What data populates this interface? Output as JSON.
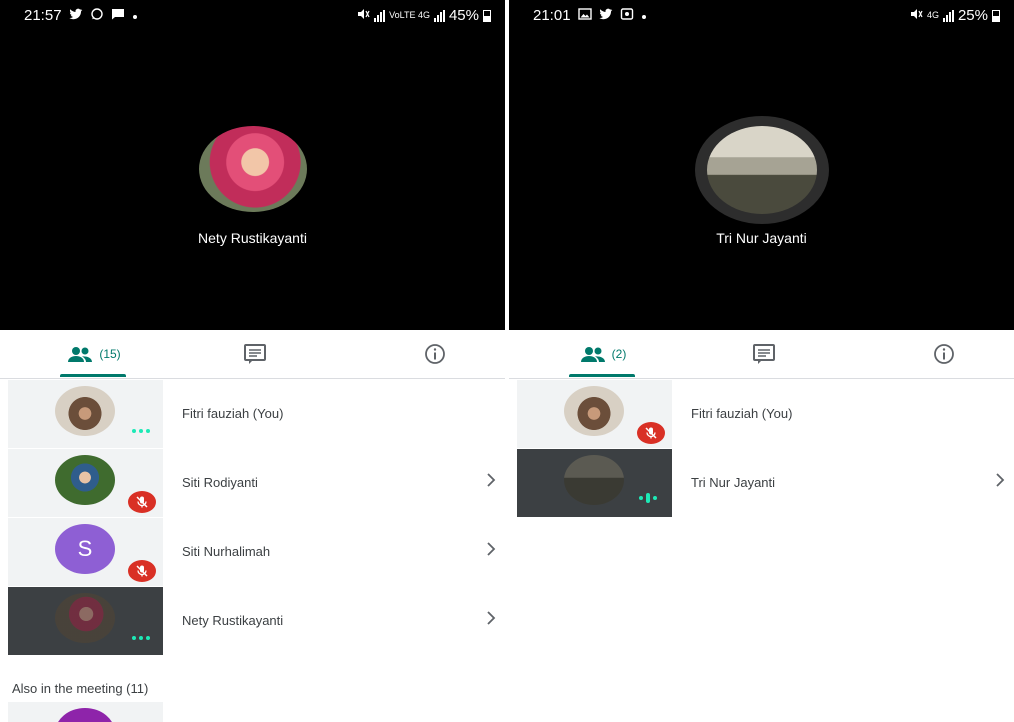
{
  "left": {
    "status_time": "21:57",
    "status_battery": "45%",
    "status_net": "VoLTE 4G",
    "stage_name": "Nety Rustikayanti",
    "people_count": "(15)",
    "participants": [
      {
        "name": "Fitri fauziah (You)"
      },
      {
        "name": "Siti Rodiyanti"
      },
      {
        "name": "Siti Nurhalimah",
        "initial": "S"
      },
      {
        "name": "Nety Rustikayanti"
      }
    ],
    "also_in_meeting": "Also in the meeting (11)"
  },
  "right": {
    "status_time": "21:01",
    "status_battery": "25%",
    "status_net": "4G",
    "stage_name": "Tri Nur Jayanti",
    "people_count": "(2)",
    "participants": [
      {
        "name": "Fitri fauziah (You)"
      },
      {
        "name": "Tri Nur Jayanti"
      }
    ]
  },
  "icons": {
    "people": "people-icon",
    "chat": "chat-icon",
    "info": "info-icon",
    "mute": "mic-off-icon",
    "chevron": "chevron-right-icon"
  },
  "colors": {
    "accent": "#00796b",
    "mute": "#d93025",
    "speaking": "#1de9b6"
  }
}
